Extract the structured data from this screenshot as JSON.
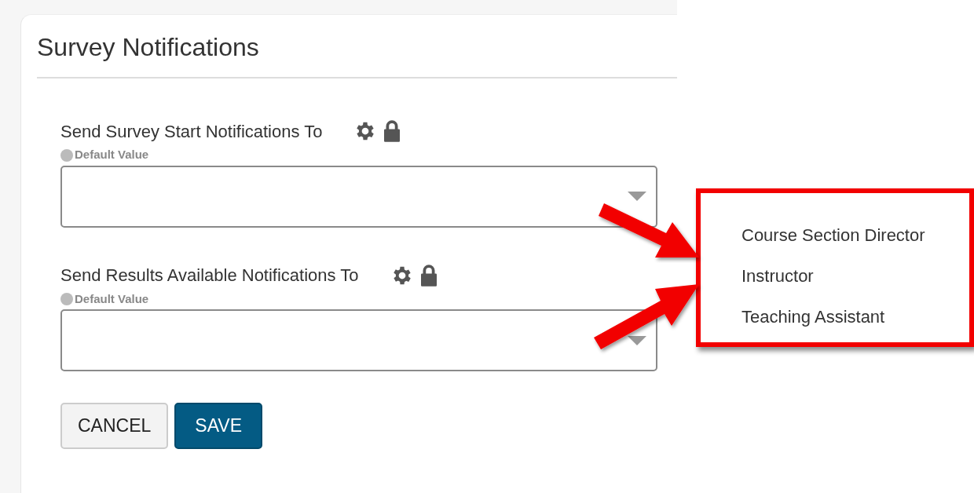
{
  "panel": {
    "title": "Survey Notifications"
  },
  "fields": [
    {
      "label": "Send Survey Start Notifications To",
      "hint": "Default Value"
    },
    {
      "label": "Send Results Available Notifications To",
      "hint": "Default Value"
    }
  ],
  "buttons": [
    {
      "label": "CANCEL",
      "kind": "secondary"
    },
    {
      "label": "SAVE",
      "kind": "primary"
    }
  ],
  "dropdown": {
    "options": [
      {
        "label": "Course Section Director"
      },
      {
        "label": "Instructor"
      },
      {
        "label": "Teaching Assistant"
      }
    ]
  }
}
